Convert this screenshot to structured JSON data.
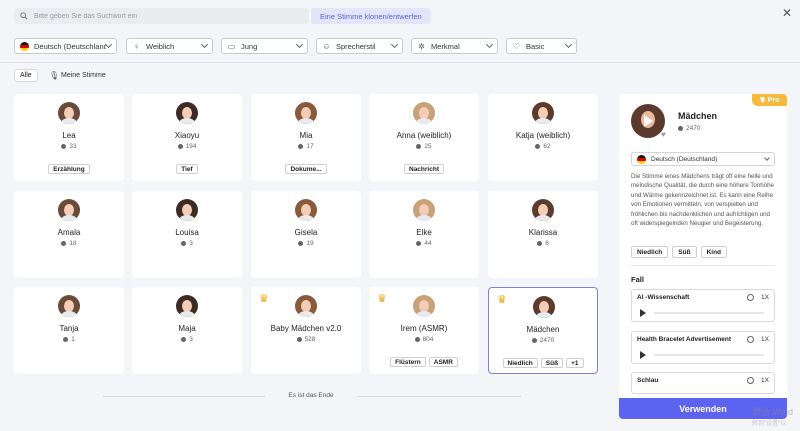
{
  "search": {
    "placeholder": "Bitte geben Sie das Suchwort ein"
  },
  "clone_button": "Eine Stimme klonen/entwerfen",
  "filters": [
    {
      "label": "Deutsch (Deutschland)",
      "icon": "flag-de-icon"
    },
    {
      "label": "Weiblich",
      "icon": "gender-icon"
    },
    {
      "label": "Jung",
      "icon": "age-icon"
    },
    {
      "label": "Sprecherstil",
      "icon": "style-icon"
    },
    {
      "label": "Merkmal",
      "icon": "feature-icon"
    },
    {
      "label": "Basic",
      "icon": "quality-icon"
    }
  ],
  "tabs": {
    "all": "Alle",
    "mine": "Meine Stimme"
  },
  "voices": [
    {
      "name": "Lea",
      "count": "33",
      "tags": [
        "Erzählung"
      ]
    },
    {
      "name": "Xiaoyu",
      "count": "194",
      "tags": [
        "Tief"
      ]
    },
    {
      "name": "Mia",
      "count": "17",
      "tags": [
        "Dokume..."
      ]
    },
    {
      "name": "Anna (weiblich)",
      "count": "25",
      "tags": [
        "Nachricht"
      ]
    },
    {
      "name": "Katja (weiblich)",
      "count": "62",
      "tags": []
    },
    {
      "name": "Amala",
      "count": "18",
      "tags": []
    },
    {
      "name": "Louisa",
      "count": "3",
      "tags": []
    },
    {
      "name": "Gisela",
      "count": "19",
      "tags": []
    },
    {
      "name": "Elke",
      "count": "44",
      "tags": []
    },
    {
      "name": "Klarissa",
      "count": "6",
      "tags": []
    },
    {
      "name": "Tanja",
      "count": "1",
      "tags": []
    },
    {
      "name": "Maja",
      "count": "3",
      "tags": []
    },
    {
      "name": "Baby Mädchen v2.0",
      "count": "528",
      "tags": [],
      "premium": true
    },
    {
      "name": "Irem (ASMR)",
      "count": "804",
      "tags": [
        "Flüstern",
        "ASMR"
      ],
      "premium": true
    },
    {
      "name": "Mädchen",
      "count": "2470",
      "tags": [
        "Niedlich",
        "Süß",
        "+1"
      ],
      "premium": true,
      "selected": true
    }
  ],
  "end_text": "Es ist das Ende",
  "detail": {
    "badge": "Pro",
    "name": "Mädchen",
    "count": "2470",
    "language": "Deutsch (Deutschland)",
    "description": "Die Stimme eines Mädchens trägt oft eine helle und melodische Qualität, die durch eine höhere Tonhöhe und Wärme gekennzeichnet ist. Es kann eine Reihe von Emotionen vermitteln, von verspielten und fröhlichen bis nachdenklichen und aufrichtigen und oft widerspiegelnden Neugier und Begeisterung.",
    "tags": [
      "Niedlich",
      "Süß",
      "Kind"
    ],
    "samples_title": "Fall",
    "samples": [
      {
        "title": "AI -Wissenschaft",
        "speed": "1X"
      },
      {
        "title": "Health Bracelet Advertisement",
        "speed": "1X"
      },
      {
        "title": "Schlau",
        "speed": "1X"
      }
    ],
    "use_button": "Verwenden"
  },
  "watermark": {
    "line1": "激活 Wind",
    "line2": "转到\"设置\"以"
  },
  "colors": {
    "accent": "#5b63f0",
    "pro": "#f6b93b",
    "crown": "#e8a710",
    "selected_border": "#7b82e0"
  }
}
